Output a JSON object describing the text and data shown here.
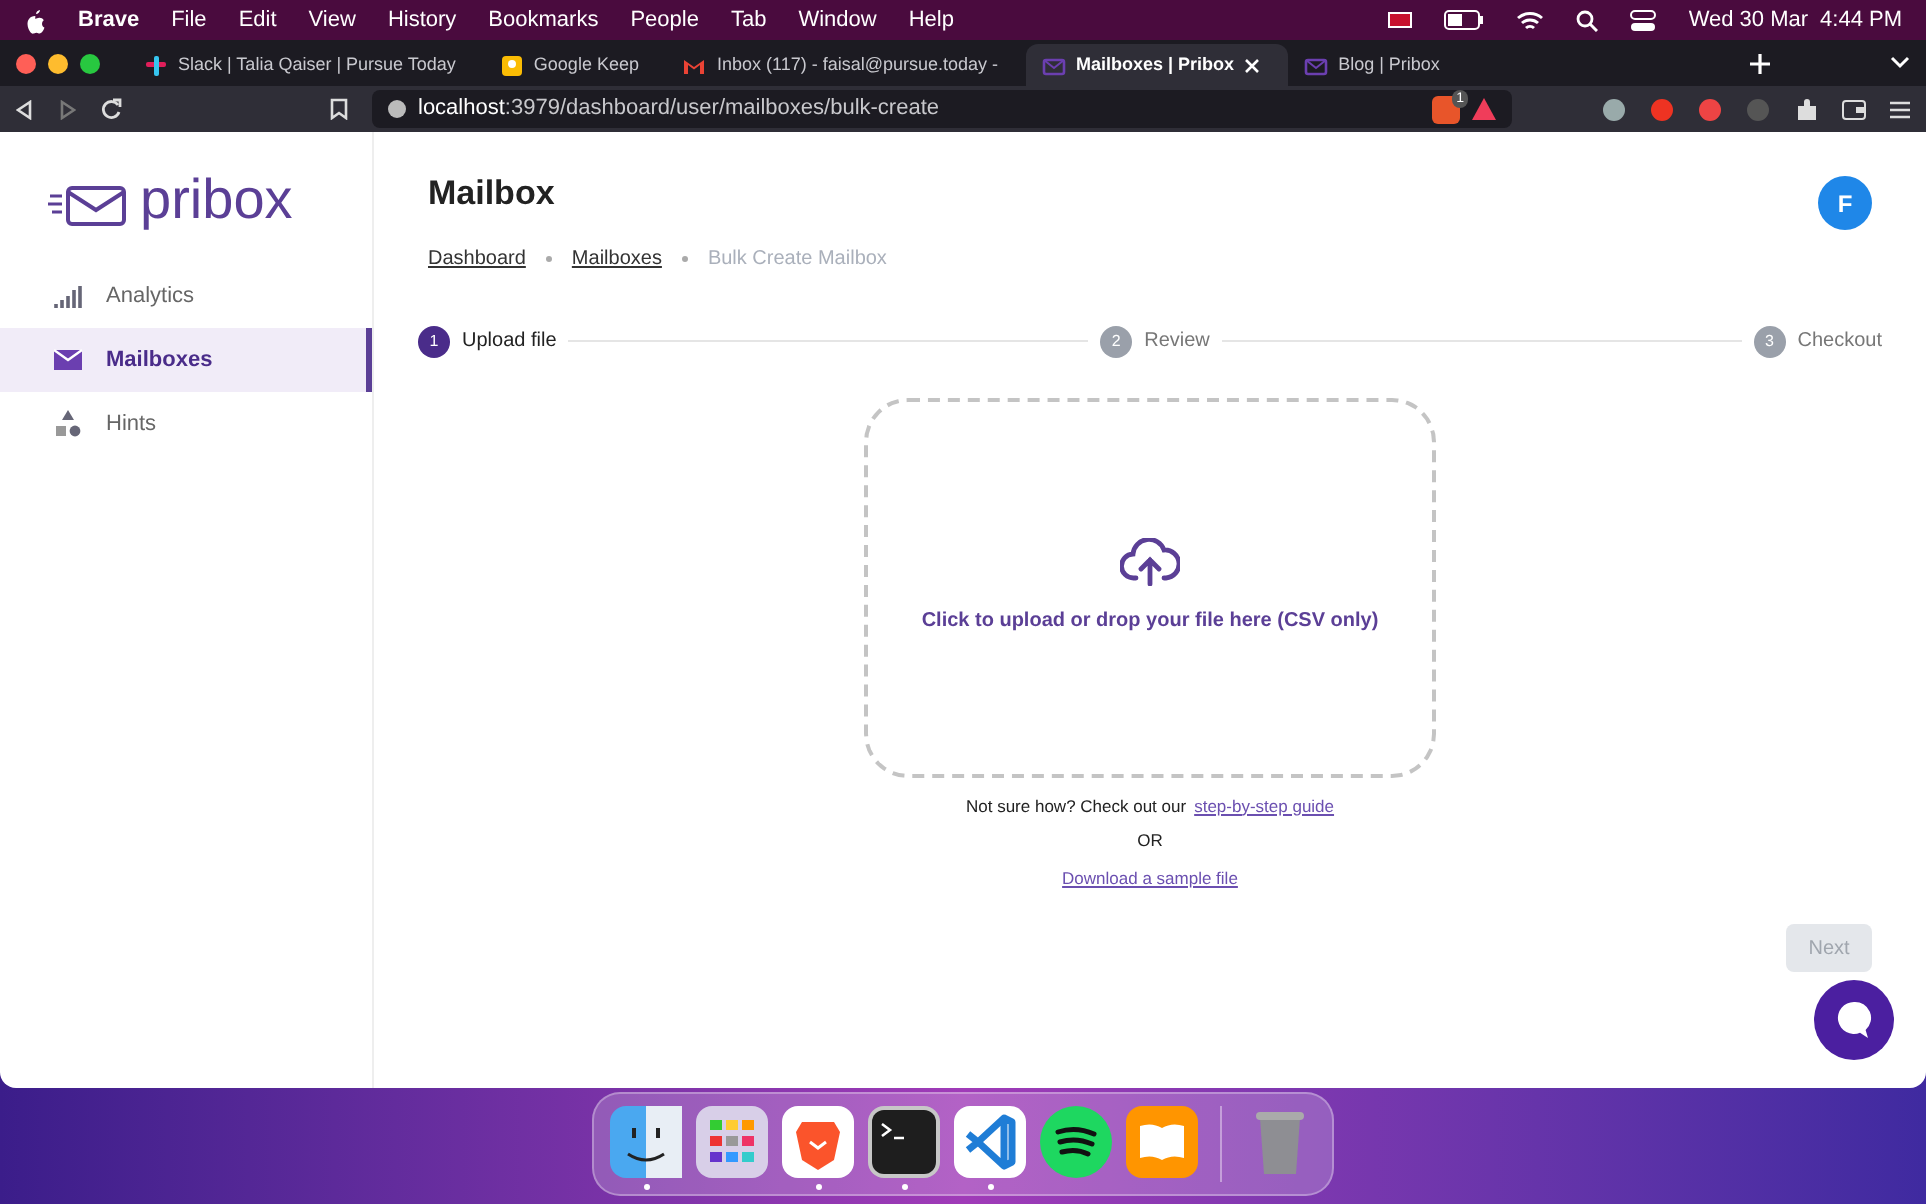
{
  "menu_bar": {
    "app": "Brave",
    "items": [
      "File",
      "Edit",
      "View",
      "History",
      "Bookmarks",
      "People",
      "Tab",
      "Window",
      "Help"
    ],
    "date": "Wed 30 Mar",
    "time": "4:44 PM"
  },
  "browser_tabs": [
    {
      "label": "Slack | Talia Qaiser | Pursue Today",
      "selected": false
    },
    {
      "label": "Google Keep",
      "selected": false
    },
    {
      "label": "Inbox (117) - faisal@pursue.today -",
      "selected": false
    },
    {
      "label": "Mailboxes | Pribox",
      "selected": true
    },
    {
      "label": "Blog | Pribox",
      "selected": false
    }
  ],
  "address_bar": {
    "host": "localhost",
    "path": ":3979/dashboard/user/mailboxes/bulk-create",
    "shield_badge": "1"
  },
  "app": {
    "logo": "pribox",
    "sidebar": [
      {
        "label": "Analytics",
        "selected": false
      },
      {
        "label": "Mailboxes",
        "selected": true
      },
      {
        "label": "Hints",
        "selected": false
      }
    ],
    "title": "Mailbox",
    "breadcrumbs": [
      {
        "label": "Dashboard",
        "kind": "link"
      },
      {
        "label": "Mailboxes",
        "kind": "link"
      },
      {
        "label": "Bulk Create Mailbox",
        "kind": "current"
      }
    ],
    "avatar": "F",
    "steps": [
      {
        "number": "1",
        "label": "Upload file",
        "selected": true
      },
      {
        "number": "2",
        "label": "Review",
        "selected": false
      },
      {
        "number": "3",
        "label": "Checkout",
        "selected": false
      }
    ],
    "upload_text": "Click to upload or drop your file here (CSV only)",
    "help_text": "Not sure how? Check out our",
    "help_link": "step-by-step guide",
    "or_text": "OR",
    "download_link": "Download a sample file",
    "next_button": {
      "label": "Next",
      "disabled": true
    }
  },
  "dock": [
    {
      "kind": "finder",
      "running": true
    },
    {
      "kind": "launchpad",
      "running": false
    },
    {
      "kind": "browser",
      "running": true
    },
    {
      "kind": "terminal",
      "running": true
    },
    {
      "kind": "editor",
      "running": true
    },
    {
      "kind": "music",
      "running": false
    },
    {
      "kind": "books",
      "running": false
    },
    {
      "kind": "trash",
      "running": false
    }
  ]
}
